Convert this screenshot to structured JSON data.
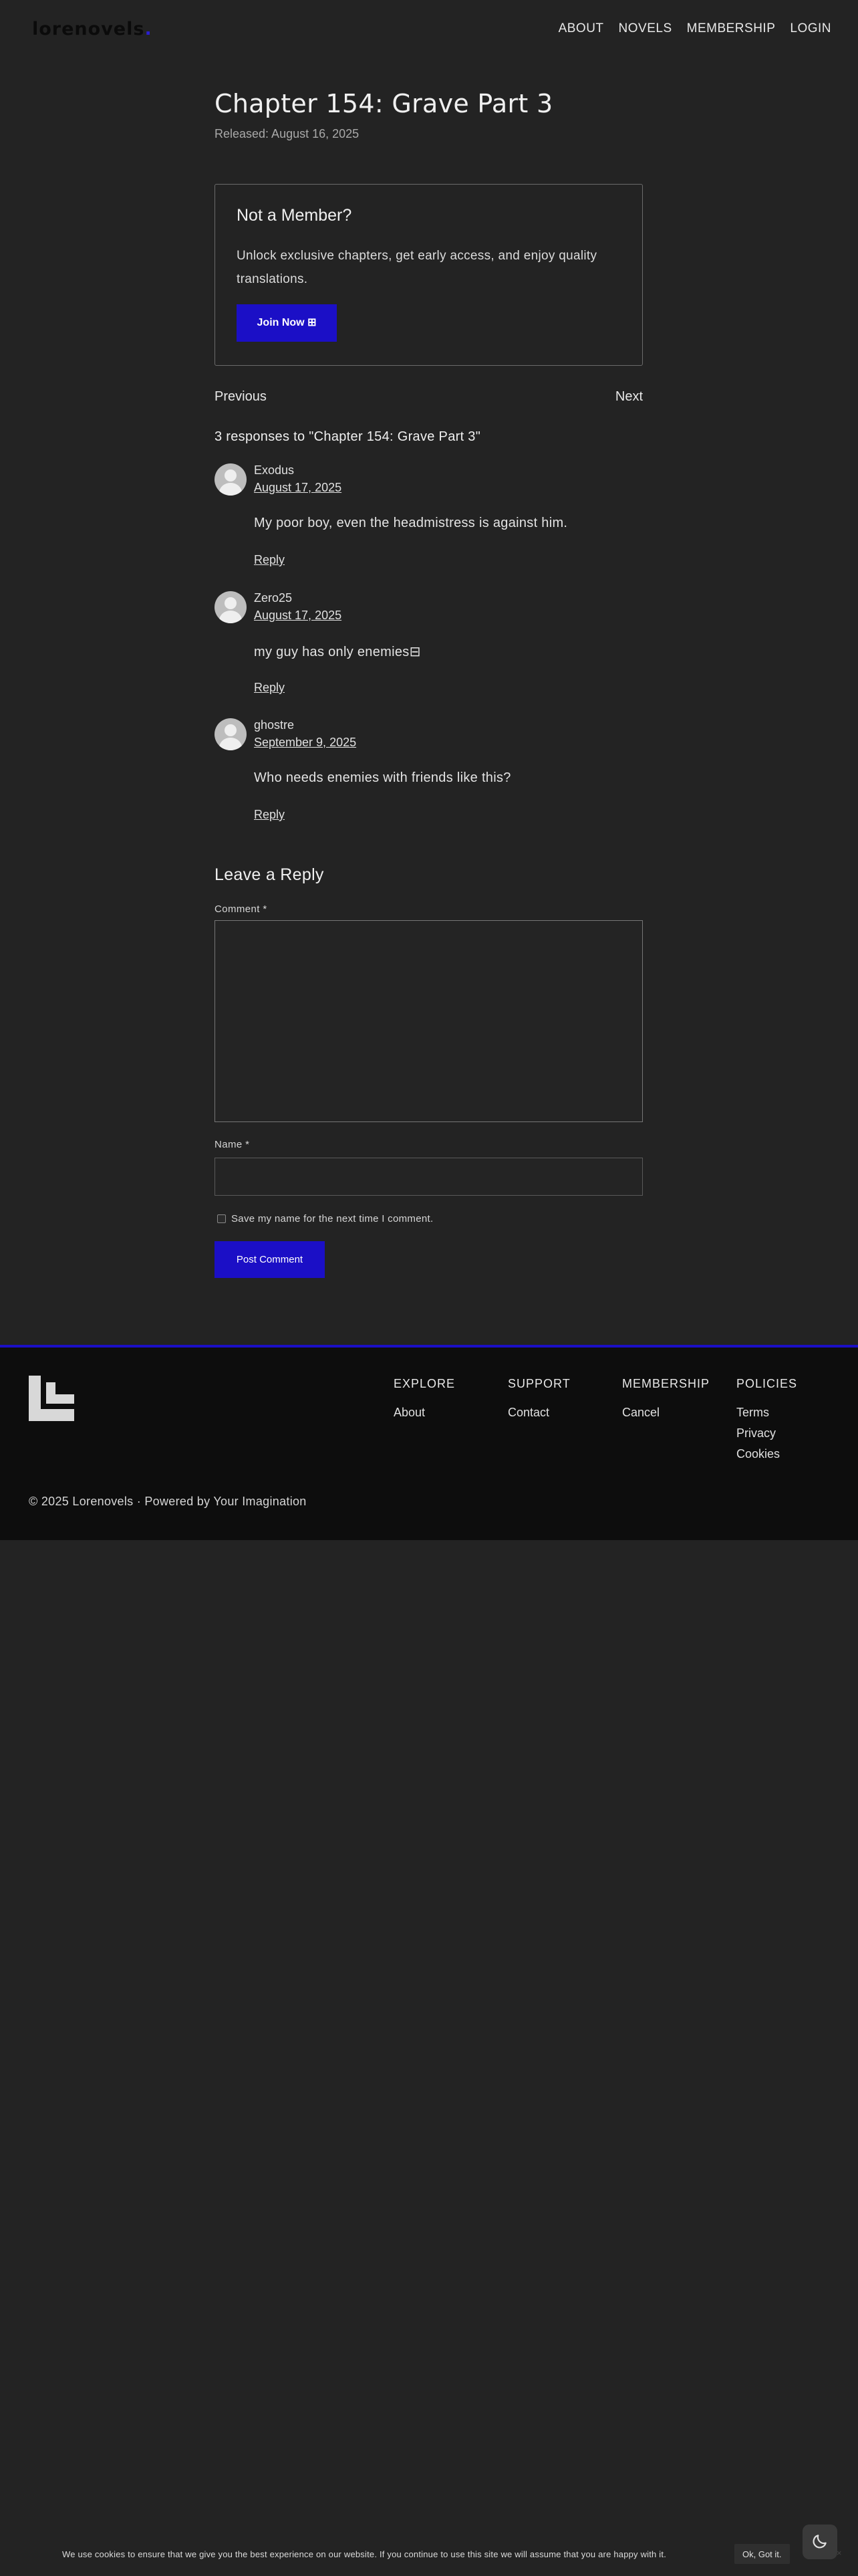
{
  "header": {
    "logo_text": "lorenovels",
    "logo_dot": ".",
    "nav": [
      "ABOUT",
      "NOVELS",
      "MEMBERSHIP",
      "LOGIN"
    ]
  },
  "post": {
    "title": "Chapter 154: Grave Part 3",
    "released": "Released: August 16, 2025"
  },
  "member_box": {
    "heading": "Not a Member?",
    "text": "Unlock exclusive chapters, get early access, and enjoy quality translations.",
    "button": "Join Now ⊞"
  },
  "post_nav": {
    "prev": "Previous",
    "next": "Next"
  },
  "comments": {
    "title": "3 responses to \"Chapter 154: Grave Part 3\"",
    "items": [
      {
        "author": "Exodus",
        "date": "August 17, 2025",
        "text": "My poor boy, even the headmistress is against him.",
        "reply": "Reply"
      },
      {
        "author": "Zero25",
        "date": "August 17, 2025",
        "text": "my guy has only enemies⊟",
        "reply": "Reply"
      },
      {
        "author": "ghostre",
        "date": "September 9, 2025",
        "text": "Who needs enemies with friends like this?",
        "reply": "Reply"
      }
    ]
  },
  "reply_form": {
    "title": "Leave a Reply",
    "comment_label": "Comment *",
    "name_label": "Name *",
    "save_label": "Save my name for the next time I comment.",
    "submit": "Post Comment"
  },
  "footer": {
    "columns": [
      {
        "heading": "EXPLORE",
        "links": [
          "About"
        ]
      },
      {
        "heading": "SUPPORT",
        "links": [
          "Contact"
        ]
      },
      {
        "heading": "MEMBERSHIP",
        "links": [
          "Cancel"
        ]
      },
      {
        "heading": "POLICIES",
        "links": [
          "Terms",
          "Privacy",
          "Cookies"
        ]
      }
    ],
    "copyright": "© 2025 Lorenovels · Powered by Your Imagination"
  },
  "cookie": {
    "text": "We use cookies to ensure that we give you the best experience on our website. If you continue to use this site we will assume that you are happy with it.",
    "ok": "Ok, Got it.",
    "close": "×"
  },
  "colors": {
    "accent": "#1b0fc6",
    "background": "#232323",
    "footer": "#0d0d0d"
  }
}
